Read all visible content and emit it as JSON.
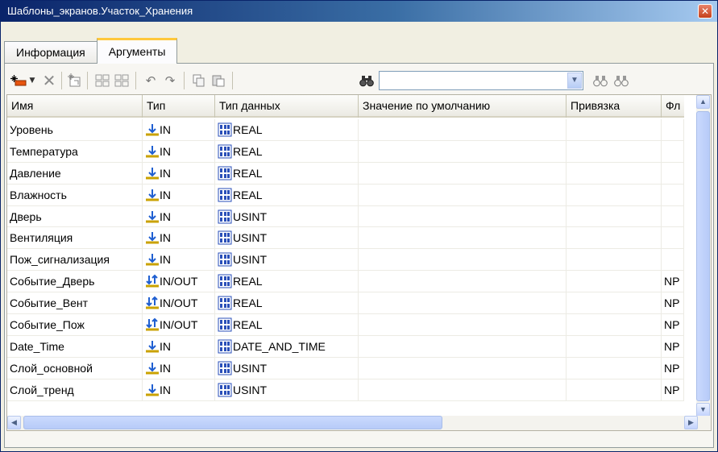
{
  "window": {
    "title": "Шаблоны_экранов.Участок_Хранения",
    "close_glyph": "✕"
  },
  "tabs": [
    {
      "label": "Информация",
      "active": false
    },
    {
      "label": "Аргументы",
      "active": true
    }
  ],
  "toolbar": {
    "buttons": [
      "add-argument-icon",
      "dropdown-arrow-icon",
      "delete-icon",
      "import-icon",
      "move-up-icon",
      "move-down-icon",
      "undo-icon",
      "redo-icon",
      "copy-icon",
      "paste-icon",
      "find-icon"
    ],
    "search": {
      "value": "",
      "placeholder": ""
    },
    "find_next_icon": "find-next-icon",
    "find_prev_icon": "find-prev-icon"
  },
  "table": {
    "columns": [
      "Имя",
      "Тип",
      "Тип данных",
      "Значение по умолчанию",
      "Привязка",
      "Фл"
    ],
    "rows": [
      {
        "name": "Уровень",
        "dir": "IN",
        "dtype": "REAL",
        "default": "",
        "binding": "",
        "flag": ""
      },
      {
        "name": "Температура",
        "dir": "IN",
        "dtype": "REAL",
        "default": "",
        "binding": "",
        "flag": ""
      },
      {
        "name": "Давление",
        "dir": "IN",
        "dtype": "REAL",
        "default": "",
        "binding": "",
        "flag": ""
      },
      {
        "name": "Влажность",
        "dir": "IN",
        "dtype": "REAL",
        "default": "",
        "binding": "",
        "flag": ""
      },
      {
        "name": "Дверь",
        "dir": "IN",
        "dtype": "USINT",
        "default": "",
        "binding": "",
        "flag": ""
      },
      {
        "name": "Вентиляция",
        "dir": "IN",
        "dtype": "USINT",
        "default": "",
        "binding": "",
        "flag": ""
      },
      {
        "name": "Пож_сигнализация",
        "dir": "IN",
        "dtype": "USINT",
        "default": "",
        "binding": "",
        "flag": ""
      },
      {
        "name": "Событие_Дверь",
        "dir": "IN/OUT",
        "dtype": "REAL",
        "default": "",
        "binding": "",
        "flag": "NP"
      },
      {
        "name": "Событие_Вент",
        "dir": "IN/OUT",
        "dtype": "REAL",
        "default": "",
        "binding": "",
        "flag": "NP"
      },
      {
        "name": "Событие_Пож",
        "dir": "IN/OUT",
        "dtype": "REAL",
        "default": "",
        "binding": "",
        "flag": "NP"
      },
      {
        "name": "Date_Time",
        "dir": "IN",
        "dtype": "DATE_AND_TIME",
        "default": "",
        "binding": "",
        "flag": "NP"
      },
      {
        "name": "Слой_основной",
        "dir": "IN",
        "dtype": "USINT",
        "default": "",
        "binding": "",
        "flag": "NP"
      },
      {
        "name": "Слой_тренд",
        "dir": "IN",
        "dtype": "USINT",
        "default": "",
        "binding": "",
        "flag": "NP"
      }
    ]
  }
}
